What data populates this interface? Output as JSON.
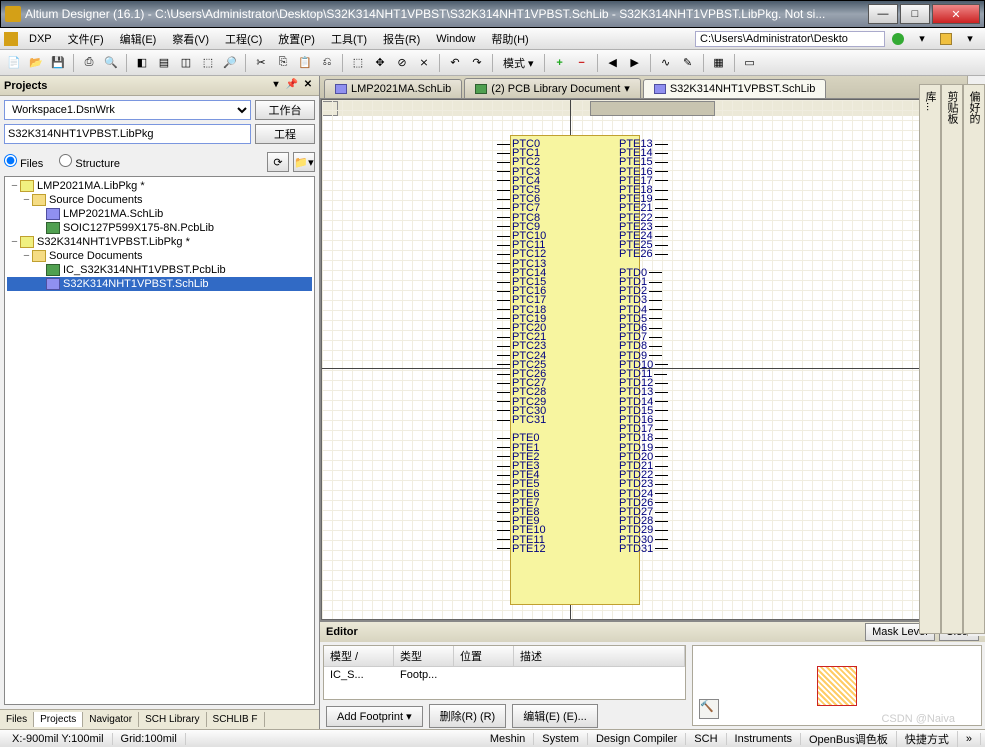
{
  "title": "Altium Designer (16.1) - C:\\Users\\Administrator\\Desktop\\S32K314NHT1VPBST\\S32K314NHT1VPBST.SchLib - S32K314NHT1VPBST.LibPkg. Not si...",
  "menu": {
    "dxp": "DXP",
    "file": "文件(F)",
    "edit": "编辑(E)",
    "view": "察看(V)",
    "project": "工程(C)",
    "place": "放置(P)",
    "tools": "工具(T)",
    "reports": "报告(R)",
    "window": "Window",
    "help": "帮助(H)"
  },
  "pathbox": "C:\\Users\\Administrator\\Deskto",
  "toolbar_mode": "模式 ▾",
  "projects_panel": {
    "title": "Projects",
    "workspace": "Workspace1.DsnWrk",
    "workbench_btn": "工作台",
    "project_name": "S32K314NHT1VPBST.LibPkg",
    "project_btn": "工程",
    "files_label": "Files",
    "structure_label": "Structure",
    "tree": [
      {
        "lvl": 0,
        "exp": "−",
        "icon": "pkg",
        "text": "LMP2021MA.LibPkg *"
      },
      {
        "lvl": 1,
        "exp": "−",
        "icon": "fld",
        "text": "Source Documents"
      },
      {
        "lvl": 2,
        "exp": "",
        "icon": "sch",
        "text": "LMP2021MA.SchLib"
      },
      {
        "lvl": 2,
        "exp": "",
        "icon": "pcb",
        "text": "SOIC127P599X175-8N.PcbLib"
      },
      {
        "lvl": 0,
        "exp": "−",
        "icon": "pkg",
        "text": "S32K314NHT1VPBST.LibPkg *"
      },
      {
        "lvl": 1,
        "exp": "−",
        "icon": "fld",
        "text": "Source Documents"
      },
      {
        "lvl": 2,
        "exp": "",
        "icon": "pcb",
        "text": "IC_S32K314NHT1VPBST.PcbLib"
      },
      {
        "lvl": 2,
        "exp": "",
        "icon": "sch",
        "text": "S32K314NHT1VPBST.SchLib",
        "selected": true
      }
    ],
    "bottom_tabs": [
      "Files",
      "Projects",
      "Navigator",
      "SCH Library",
      "SCHLIB F"
    ],
    "bottom_active": 1
  },
  "doc_tabs": [
    {
      "icon": "sch",
      "label": "LMP2021MA.SchLib"
    },
    {
      "icon": "pcb",
      "label": "(2) PCB Library Document",
      "drop": true
    },
    {
      "icon": "sch",
      "label": "S32K314NHT1VPBST.SchLib",
      "active": true
    }
  ],
  "chip": {
    "left": [
      "PTC0",
      "PTC1",
      "PTC2",
      "PTC3",
      "PTC4",
      "PTC5",
      "PTC6",
      "PTC7",
      "PTC8",
      "PTC9",
      "PTC10",
      "PTC11",
      "PTC12",
      "PTC13",
      "PTC14",
      "PTC15",
      "PTC16",
      "PTC17",
      "PTC18",
      "PTC19",
      "PTC20",
      "PTC21",
      "PTC23",
      "PTC24",
      "PTC25",
      "PTC26",
      "PTC27",
      "PTC28",
      "PTC29",
      "PTC30",
      "PTC31",
      "",
      "PTE0",
      "PTE1",
      "PTE2",
      "PTE3",
      "PTE4",
      "PTE5",
      "PTE6",
      "PTE7",
      "PTE8",
      "PTE9",
      "PTE10",
      "PTE11",
      "PTE12"
    ],
    "right": [
      "PTE13",
      "PTE14",
      "PTE15",
      "PTE16",
      "PTE17",
      "PTE18",
      "PTE19",
      "PTE21",
      "PTE22",
      "PTE23",
      "PTE24",
      "PTE25",
      "PTE26",
      "",
      "PTD0",
      "PTD1",
      "PTD2",
      "PTD3",
      "PTD4",
      "PTD5",
      "PTD6",
      "PTD7",
      "PTD8",
      "PTD9",
      "PTD10",
      "PTD11",
      "PTD12",
      "PTD13",
      "PTD14",
      "PTD15",
      "PTD16",
      "PTD17",
      "PTD18",
      "PTD19",
      "PTD20",
      "PTD21",
      "PTD22",
      "PTD23",
      "PTD24",
      "PTD26",
      "PTD27",
      "PTD28",
      "PTD29",
      "PTD30",
      "PTD31"
    ]
  },
  "editor": {
    "title": "Editor",
    "mask": "Mask Level",
    "clear": "Clear",
    "cols": [
      "模型  /",
      "类型",
      "位置",
      "描述"
    ],
    "row": [
      "IC_S...",
      "Footp..."
    ],
    "add": "Add Footprint",
    "delete": "删除(R) (R)",
    "edit": "编辑(E) (E)..."
  },
  "right_tabs": [
    "偏好的",
    "剪贴板",
    "库..."
  ],
  "status": {
    "coords": "X:-900mil Y:100mil",
    "grid": "Grid:100mil",
    "right": [
      "Meshin",
      "System",
      "Design Compiler",
      "SCH",
      "Instruments",
      "OpenBus调色板",
      "快捷方式"
    ]
  },
  "watermark": "CSDN @Naiva"
}
